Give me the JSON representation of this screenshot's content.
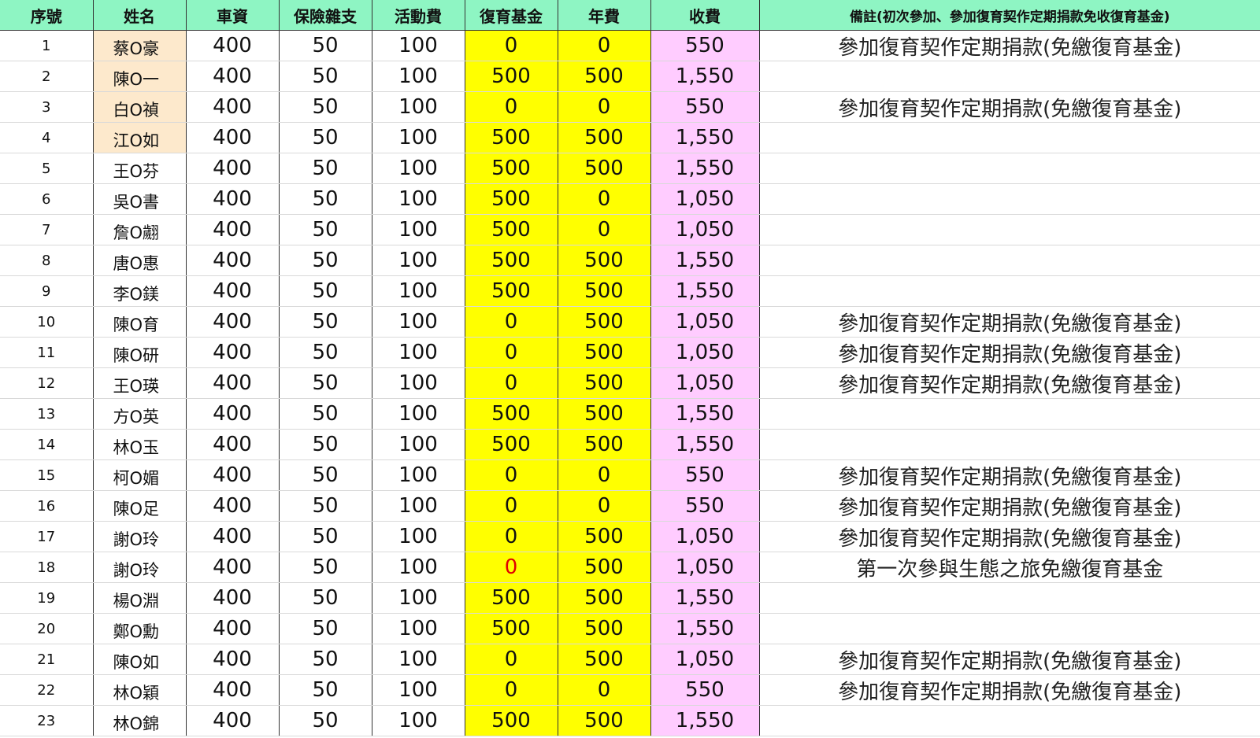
{
  "headers": {
    "seq": "序號",
    "name": "姓名",
    "fare": "車資",
    "insurance": "保險雜支",
    "activity": "活動費",
    "restoration": "復育基金",
    "annual": "年費",
    "total": "收費",
    "remark": "備註(初次參加、參加復育契作定期捐款免收復育基金)"
  },
  "colors": {
    "header_bg": "#8ef5c3",
    "highlight_name_bg": "#fde9cc",
    "yellow_col": "#ffff00",
    "pink_col": "#ffccff",
    "red_value": "#e00000"
  },
  "rows": [
    {
      "seq": "1",
      "name": "蔡O豪",
      "fare": "400",
      "insurance": "50",
      "activity": "100",
      "restoration": "0",
      "annual": "0",
      "total": "550",
      "remark": "參加復育契作定期捐款(免繳復育基金)"
    },
    {
      "seq": "2",
      "name": "陳O一",
      "fare": "400",
      "insurance": "50",
      "activity": "100",
      "restoration": "500",
      "annual": "500",
      "total": "1,550",
      "remark": ""
    },
    {
      "seq": "3",
      "name": "白O禎",
      "fare": "400",
      "insurance": "50",
      "activity": "100",
      "restoration": "0",
      "annual": "0",
      "total": "550",
      "remark": "參加復育契作定期捐款(免繳復育基金)"
    },
    {
      "seq": "4",
      "name": "江O如",
      "fare": "400",
      "insurance": "50",
      "activity": "100",
      "restoration": "500",
      "annual": "500",
      "total": "1,550",
      "remark": ""
    },
    {
      "seq": "5",
      "name": "王O芬",
      "fare": "400",
      "insurance": "50",
      "activity": "100",
      "restoration": "500",
      "annual": "500",
      "total": "1,550",
      "remark": ""
    },
    {
      "seq": "6",
      "name": "吳O書",
      "fare": "400",
      "insurance": "50",
      "activity": "100",
      "restoration": "500",
      "annual": "0",
      "total": "1,050",
      "remark": ""
    },
    {
      "seq": "7",
      "name": "詹O翽",
      "fare": "400",
      "insurance": "50",
      "activity": "100",
      "restoration": "500",
      "annual": "0",
      "total": "1,050",
      "remark": ""
    },
    {
      "seq": "8",
      "name": "唐O惠",
      "fare": "400",
      "insurance": "50",
      "activity": "100",
      "restoration": "500",
      "annual": "500",
      "total": "1,550",
      "remark": ""
    },
    {
      "seq": "9",
      "name": "李O鎂",
      "fare": "400",
      "insurance": "50",
      "activity": "100",
      "restoration": "500",
      "annual": "500",
      "total": "1,550",
      "remark": ""
    },
    {
      "seq": "10",
      "name": "陳O育",
      "fare": "400",
      "insurance": "50",
      "activity": "100",
      "restoration": "0",
      "annual": "500",
      "total": "1,050",
      "remark": "參加復育契作定期捐款(免繳復育基金)"
    },
    {
      "seq": "11",
      "name": "陳O研",
      "fare": "400",
      "insurance": "50",
      "activity": "100",
      "restoration": "0",
      "annual": "500",
      "total": "1,050",
      "remark": "參加復育契作定期捐款(免繳復育基金)"
    },
    {
      "seq": "12",
      "name": "王O瑛",
      "fare": "400",
      "insurance": "50",
      "activity": "100",
      "restoration": "0",
      "annual": "500",
      "total": "1,050",
      "remark": "參加復育契作定期捐款(免繳復育基金)"
    },
    {
      "seq": "13",
      "name": "方O英",
      "fare": "400",
      "insurance": "50",
      "activity": "100",
      "restoration": "500",
      "annual": "500",
      "total": "1,550",
      "remark": ""
    },
    {
      "seq": "14",
      "name": "林O玉",
      "fare": "400",
      "insurance": "50",
      "activity": "100",
      "restoration": "500",
      "annual": "500",
      "total": "1,550",
      "remark": ""
    },
    {
      "seq": "15",
      "name": "柯O媚",
      "fare": "400",
      "insurance": "50",
      "activity": "100",
      "restoration": "0",
      "annual": "0",
      "total": "550",
      "remark": "參加復育契作定期捐款(免繳復育基金)"
    },
    {
      "seq": "16",
      "name": "陳O足",
      "fare": "400",
      "insurance": "50",
      "activity": "100",
      "restoration": "0",
      "annual": "0",
      "total": "550",
      "remark": "參加復育契作定期捐款(免繳復育基金)"
    },
    {
      "seq": "17",
      "name": "謝O玲",
      "fare": "400",
      "insurance": "50",
      "activity": "100",
      "restoration": "0",
      "annual": "500",
      "total": "1,050",
      "remark": "參加復育契作定期捐款(免繳復育基金)"
    },
    {
      "seq": "18",
      "name": "謝O玲",
      "fare": "400",
      "insurance": "50",
      "activity": "100",
      "restoration": "0",
      "annual": "500",
      "total": "1,050",
      "remark": "第一次參與生態之旅免繳復育基金"
    },
    {
      "seq": "19",
      "name": "楊O淵",
      "fare": "400",
      "insurance": "50",
      "activity": "100",
      "restoration": "500",
      "annual": "500",
      "total": "1,550",
      "remark": ""
    },
    {
      "seq": "20",
      "name": "鄭O勳",
      "fare": "400",
      "insurance": "50",
      "activity": "100",
      "restoration": "500",
      "annual": "500",
      "total": "1,550",
      "remark": ""
    },
    {
      "seq": "21",
      "name": "陳O如",
      "fare": "400",
      "insurance": "50",
      "activity": "100",
      "restoration": "0",
      "annual": "500",
      "total": "1,050",
      "remark": "參加復育契作定期捐款(免繳復育基金)"
    },
    {
      "seq": "22",
      "name": "林O穎",
      "fare": "400",
      "insurance": "50",
      "activity": "100",
      "restoration": "0",
      "annual": "0",
      "total": "550",
      "remark": "參加復育契作定期捐款(免繳復育基金)"
    },
    {
      "seq": "23",
      "name": "林O錦",
      "fare": "400",
      "insurance": "50",
      "activity": "100",
      "restoration": "500",
      "annual": "500",
      "total": "1,550",
      "remark": ""
    }
  ]
}
